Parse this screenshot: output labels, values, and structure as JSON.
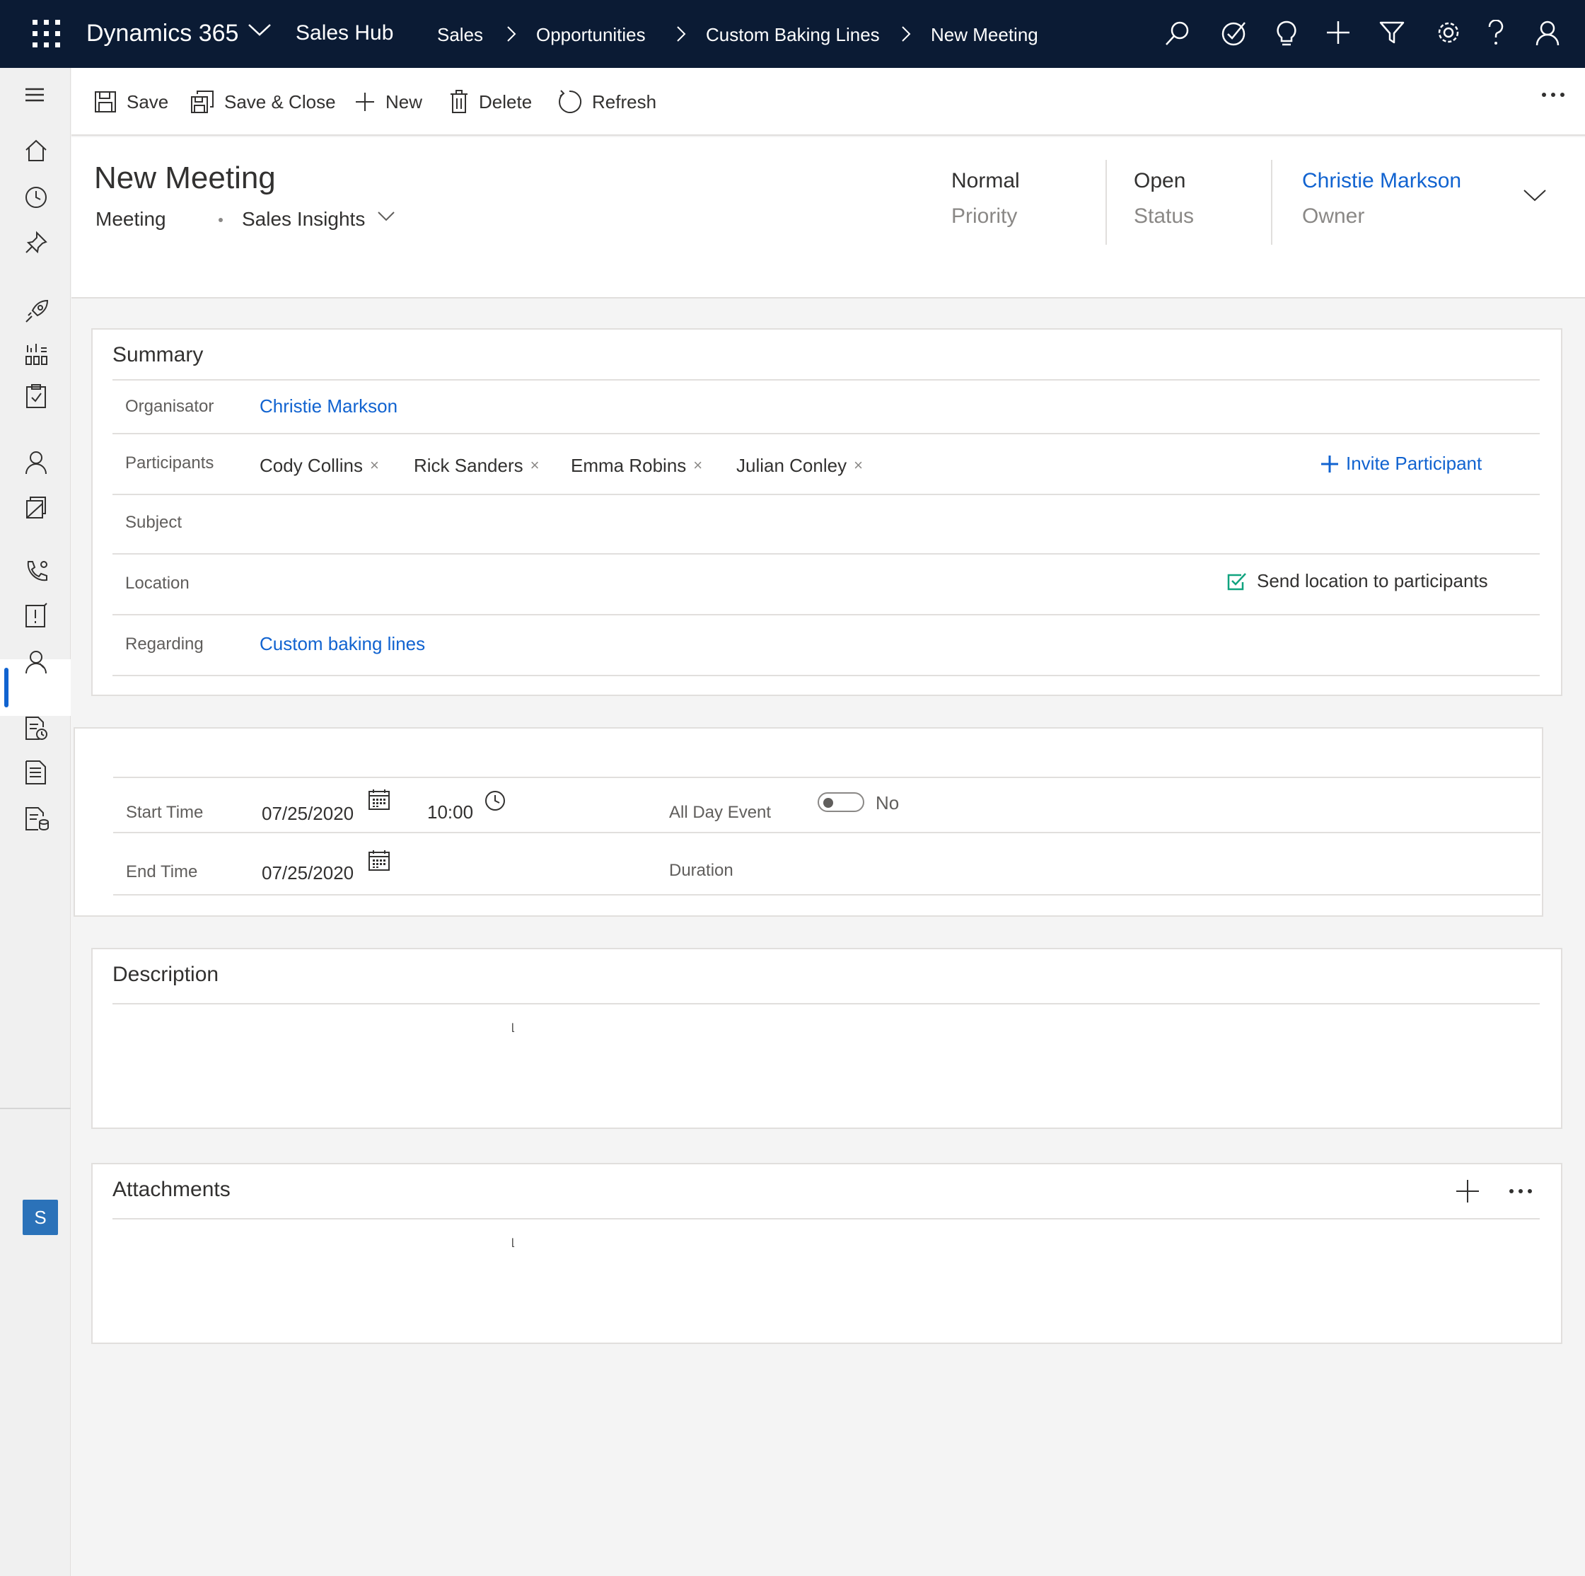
{
  "topbar": {
    "brand": "Dynamics 365",
    "app": "Sales Hub",
    "breadcrumbs": [
      "Sales",
      "Opportunities",
      "Custom Baking Lines",
      "New Meeting"
    ],
    "icons": [
      "search-icon",
      "task-check-icon",
      "lightbulb-icon",
      "plus-icon",
      "filter-icon",
      "settings-icon",
      "help-icon",
      "user-icon"
    ]
  },
  "command_bar": {
    "save": "Save",
    "save_close": "Save & Close",
    "new": "New",
    "delete": "Delete",
    "refresh": "Refresh"
  },
  "header": {
    "title": "New Meeting",
    "entity_type": "Meeting",
    "form_name": "Sales Insights",
    "priority_value": "Normal",
    "priority_label": "Priority",
    "status_value": "Open",
    "status_label": "Status",
    "owner_value": "Christie Markson",
    "owner_label": "Owner"
  },
  "summary": {
    "title": "Summary",
    "organizer_label": "Organisator",
    "organizer_value": "Christie Markson",
    "participants_label": "Participants",
    "participants": [
      "Cody Collins",
      "Rick Sanders",
      "Emma Robins",
      "Julian Conley"
    ],
    "remove_glyph": "×",
    "invite_label": "Invite Participant",
    "subject_label": "Subject",
    "subject_value": "",
    "location_label": "Location",
    "location_value": "",
    "send_location_label": "Send location to participants",
    "send_location_checked": true,
    "regarding_label": "Regarding",
    "regarding_value": "Custom baking lines"
  },
  "schedule": {
    "start_label": "Start Time",
    "start_date": "07/25/2020",
    "start_time": "10:00",
    "all_day_label": "All Day Event",
    "all_day_value": "No",
    "end_label": "End Time",
    "end_date": "07/25/2020",
    "duration_label": "Duration",
    "duration_value": ""
  },
  "description": {
    "title": "Description",
    "value": ""
  },
  "attachments": {
    "title": "Attachments"
  },
  "left_nav": {
    "avatar_letter": "S"
  },
  "colors": {
    "topbar": "#0b1b34",
    "accent": "#1163d0",
    "check_green": "#10a37f",
    "avatar": "#2b72b9"
  }
}
